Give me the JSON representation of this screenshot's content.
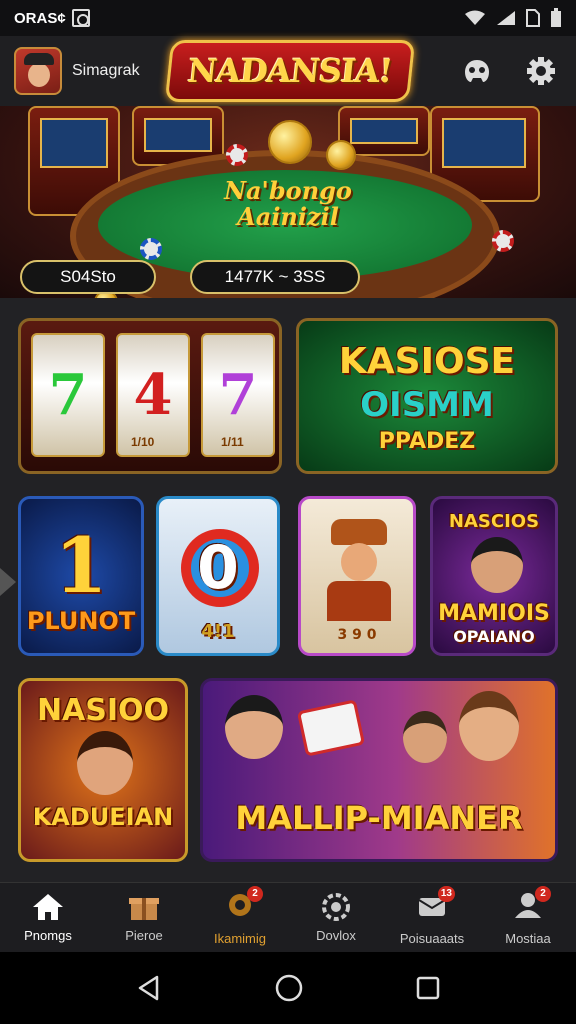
{
  "status_bar": {
    "time": "ORAS¢",
    "icons": [
      "nfc-icon",
      "wifi-icon",
      "signal-icon",
      "sim-icon",
      "battery-icon"
    ]
  },
  "top_bar": {
    "username": "Simagrak",
    "logo_text": "NADANSIA!",
    "icons": [
      "controller-icon",
      "gear-icon"
    ]
  },
  "hero": {
    "title_line1": "Na'bongo",
    "title_line2": "Aainizil",
    "pill_left": "S04Sto",
    "pill_right": "1477K ~ 3SS"
  },
  "games": {
    "slot_reels": [
      "7",
      "4",
      "7"
    ],
    "slot_sub": [
      "1/10",
      "1/11"
    ],
    "kasiose": {
      "line1": "KASIOSE",
      "line2": "OISMM",
      "line3": "PPADEZ"
    },
    "seven_card": {
      "number": "1",
      "label": "PLUNOT"
    },
    "zero_card": {
      "number": "0",
      "label": "4!1"
    },
    "cowboy_card": {
      "label": "3 9 0"
    },
    "nascios_card": {
      "line1": "NASCIOS",
      "line2": "MAMIOIS",
      "line3": "OPAIANO"
    },
    "nasioo_card": {
      "line1": "NASIOO",
      "line2": "KADUEIAN"
    },
    "mallip_card": {
      "label": "MALLIP-MIANER"
    }
  },
  "bottom_nav": [
    {
      "label": "Pnomgs",
      "icon": "home-icon",
      "badge": ""
    },
    {
      "label": "Pieroe",
      "icon": "gift-icon",
      "badge": ""
    },
    {
      "label": "Ikamimig",
      "icon": "clover-icon",
      "badge": "2"
    },
    {
      "label": "Dovlox",
      "icon": "poker-chip-icon",
      "badge": ""
    },
    {
      "label": "Poisuaaats",
      "icon": "mailbox-icon",
      "badge": "13"
    },
    {
      "label": "Mostiaa",
      "icon": "profile-icon",
      "badge": "2"
    }
  ],
  "system_nav": [
    "back-icon",
    "home-circle-icon",
    "recents-icon"
  ],
  "colors": {
    "accent_gold": "#ffd23a",
    "badge_red": "#d0281e",
    "felt_green": "#22a04a"
  }
}
